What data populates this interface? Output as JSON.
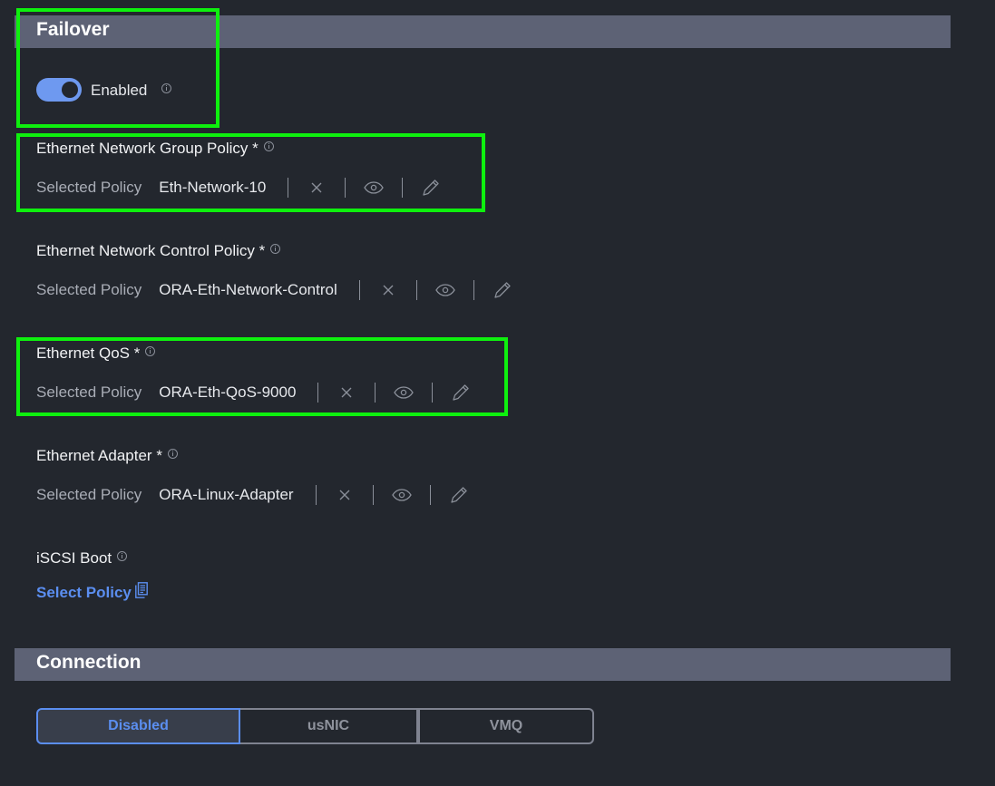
{
  "failover": {
    "title": "Failover",
    "toggle_state": "on",
    "toggle_label": "Enabled"
  },
  "policies": [
    {
      "title": "Ethernet Network Group Policy *",
      "selected_label": "Selected Policy",
      "value": "Eth-Network-10"
    },
    {
      "title": "Ethernet Network Control Policy *",
      "selected_label": "Selected Policy",
      "value": "ORA-Eth-Network-Control"
    },
    {
      "title": "Ethernet QoS *",
      "selected_label": "Selected Policy",
      "value": "ORA-Eth-QoS-9000"
    },
    {
      "title": "Ethernet Adapter *",
      "selected_label": "Selected Policy",
      "value": "ORA-Linux-Adapter"
    }
  ],
  "iscsi": {
    "title": "iSCSI Boot",
    "select_label": "Select Policy"
  },
  "connection": {
    "title": "Connection",
    "options": [
      "Disabled",
      "usNIC",
      "VMQ"
    ],
    "selected": "Disabled"
  },
  "colors": {
    "background": "#23272e",
    "header": "#5d6275",
    "accent": "#5b8ef0",
    "toggle_on": "#6e99f0",
    "highlight": "#0ef00e"
  }
}
